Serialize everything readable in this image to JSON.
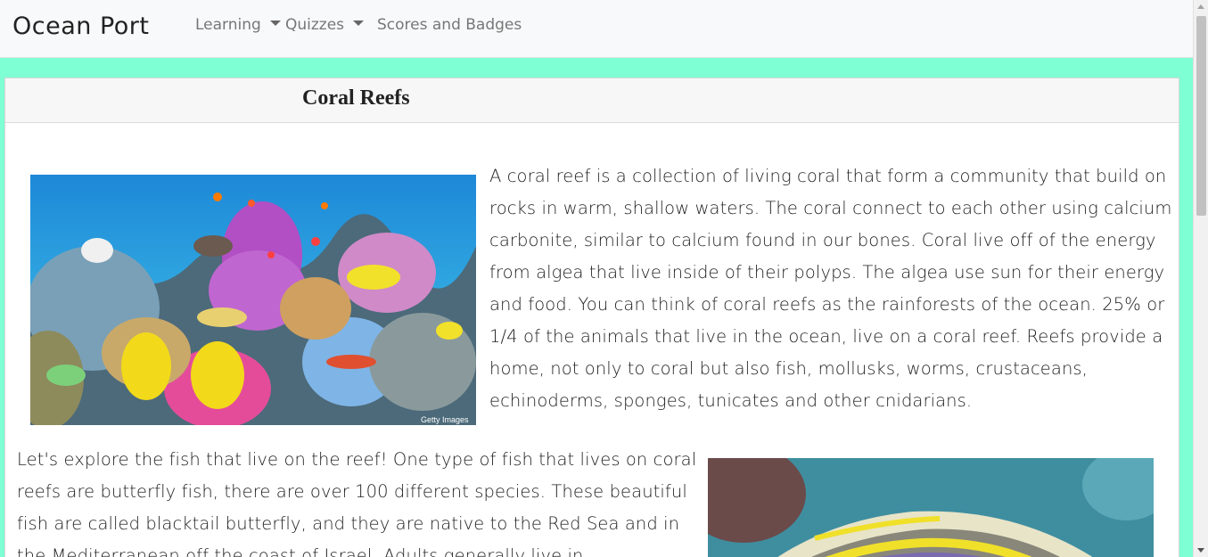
{
  "navbar": {
    "brand": "Ocean Port",
    "items": [
      {
        "label": "Learning",
        "dropdown": true
      },
      {
        "label": "Quizzes",
        "dropdown": true
      },
      {
        "label": "Scores and Badges",
        "dropdown": false
      }
    ]
  },
  "page": {
    "title": "Coral Reefs",
    "paragraph1": "A coral reef is a collection of living coral that form a community that build on rocks in warm, shallow waters. The coral connect to each other using calcium carbonite, similar to calcium found in our bones. Coral live off of the energy from algea that live inside of their polyps. The algea use sun for their energy and food. You can think of coral reefs as the rainforests of the ocean. 25% or 1/4 of the animals that live in the ocean, live on a coral reef. Reefs provide a home, not only to coral but also fish, mollusks, worms, crustaceans, echinoderms, sponges, tunicates and other cnidarians.",
    "paragraph2": "Let's explore the fish that live on the reef! One type of fish that lives on coral reefs are butterfly fish, there are over 100 different species. These beautiful fish are called blacktail butterfly, and they are native to the Red Sea and in the Mediterranean off the coast of Israel. Adults generally live in",
    "image1_credit": "Getty Images"
  },
  "colors": {
    "page_background": "#7fffd4",
    "navbar_background": "#f8f9fa"
  }
}
